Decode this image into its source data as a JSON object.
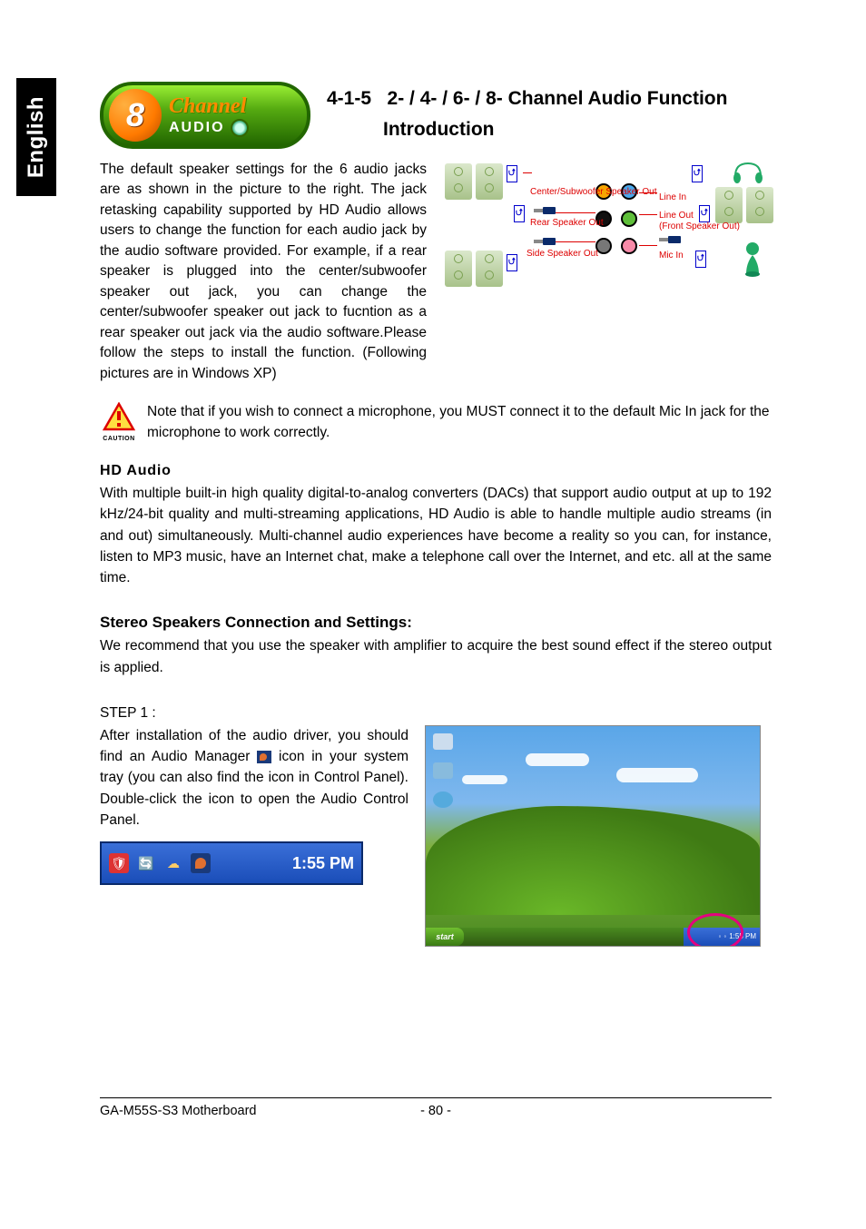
{
  "side_tab": "English",
  "logo": {
    "num": "8",
    "line1": "Channel",
    "line2": "AUDIO"
  },
  "title": {
    "section_num": "4-1-5",
    "line1": "2- / 4- / 6- / 8- Channel Audio Function",
    "line2": "Introduction"
  },
  "intro_paragraph": "The default speaker settings for the 6 audio jacks are as shown in the picture to the right. The jack retasking capability supported by HD Audio allows users to change the function for each audio jack by the audio software provided. For example, if  a rear speaker is plugged into the center/subwoofer speaker out jack, you can change the center/subwoofer speaker out jack to fucntion as a rear speaker out jack via the audio software.Please follow the steps to install the function. (Following pictures are in Windows XP)",
  "diagram": {
    "left_labels": {
      "top": "Center/Subwoofer Speaker Out",
      "mid": "Rear Speaker Out",
      "bot": "Side Speaker Out"
    },
    "right_labels": {
      "top": "Line In",
      "mid1": "Line Out",
      "mid2": "(Front Speaker Out)",
      "bot": "Mic In"
    }
  },
  "caution": {
    "label": "CAUTION",
    "text": "Note that if you wish to connect a microphone, you MUST connect it to the default Mic In jack for the microphone to work correctly."
  },
  "hd_audio": {
    "heading": "HD Audio",
    "body": "With multiple built-in high quality digital-to-analog converters (DACs) that support audio output at up to 192 kHz/24-bit quality and multi-streaming applications, HD Audio is able to handle multiple audio streams (in and out) simultaneously. Multi-channel audio experiences have become a reality so you can, for instance,  listen to MP3 music, have an Internet chat, make a telephone call over the Internet, and etc. all at the same time."
  },
  "stereo": {
    "heading": "Stereo Speakers Connection and Settings:",
    "body": "We recommend that you use the speaker with amplifier to acquire the best sound effect if the stereo output is applied."
  },
  "step1": {
    "label": "STEP 1 :",
    "text_before": "After installation of the audio driver, you should find an Audio Manager",
    "text_after": "icon in your system tray (you can also find the icon in Control Panel).  Double-click the icon to open the Audio Control Panel."
  },
  "systray": {
    "clock": "1:55 PM"
  },
  "desktop": {
    "start": "start",
    "clock": "1:55 PM"
  },
  "footer": {
    "left": "GA-M55S-S3 Motherboard",
    "page": "- 80 -"
  }
}
